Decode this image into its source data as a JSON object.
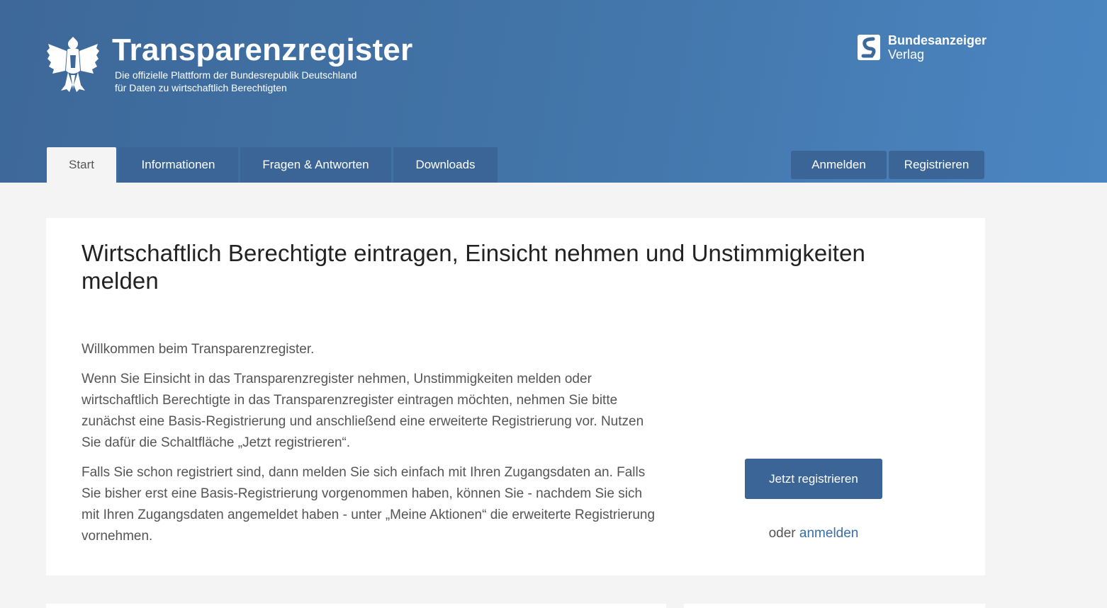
{
  "header": {
    "title": "Transparenzregister",
    "subtitle_line1": "Die offizielle Plattform der Bundesrepublik Deutschland",
    "subtitle_line2": "für Daten zu wirtschaftlich Berechtigten",
    "publisher_name": "Bundesanzeiger",
    "publisher_sub": "Verlag",
    "brand_color": "#3a6596"
  },
  "nav": {
    "tabs": [
      {
        "label": "Start",
        "active": true
      },
      {
        "label": "Informationen",
        "active": false
      },
      {
        "label": "Fragen & Antworten",
        "active": false
      },
      {
        "label": "Downloads",
        "active": false
      }
    ],
    "login_label": "Anmelden",
    "register_label": "Registrieren"
  },
  "main": {
    "title": "Wirtschaftlich Berechtigte eintragen, Einsicht nehmen und Unstimmigkeiten melden",
    "paragraphs": [
      "Willkommen beim Transparenzregister.",
      "Wenn Sie Einsicht in das Transparenzregister nehmen, Unstimmigkeiten melden oder wirtschaftlich Berechtigte in das Transparenzregister eintragen möchten, nehmen Sie bitte zunächst eine Basis-Registrierung und anschließend eine erweiterte Registrierung vor. Nutzen Sie dafür die Schaltfläche „Jetzt registrieren“.",
      "Falls Sie schon registriert sind, dann melden Sie sich einfach mit Ihren Zugangsdaten an. Falls Sie bisher erst eine Basis-Registrierung vorgenommen haben, können Sie - nachdem Sie sich mit Ihren Zugangsdaten angemeldet haben - unter „Meine Aktionen“ die erweiterte Registrierung vornehmen."
    ],
    "cta_label": "Jetzt registrieren",
    "or_text": "oder",
    "login_link": "anmelden"
  }
}
